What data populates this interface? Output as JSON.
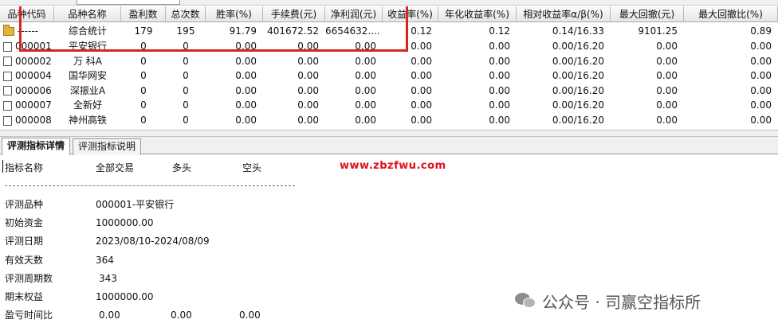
{
  "grid": {
    "columns": [
      "品种代码",
      "品种名称",
      "盈利数",
      "总次数",
      "胜率(%)",
      "手续费(元)",
      "净利润(元)",
      "收益率(%)",
      "年化收益率(%)",
      "相对收益率α/β(%)",
      "最大回撤(元)",
      "最大回撤比(%)"
    ],
    "summary_row": {
      "code": "------",
      "name": "综合统计",
      "win": "179",
      "total": "195",
      "winrate": "91.79",
      "fee": "401672.52",
      "profit": "6654632....",
      "ret": "0.12",
      "annual": "0.12",
      "alpha": "0.14/16.33",
      "maxdd": "9101.25",
      "maxddpct": "0.89"
    },
    "rows": [
      {
        "code": "000001",
        "name": "平安银行",
        "win": "0",
        "total": "0",
        "winrate": "0.00",
        "fee": "0.00",
        "profit": "0.00",
        "ret": "0.00",
        "annual": "0.00",
        "alpha": "0.00/16.20",
        "maxdd": "0.00",
        "maxddpct": "0.00"
      },
      {
        "code": "000002",
        "name": "万 科A",
        "win": "0",
        "total": "0",
        "winrate": "0.00",
        "fee": "0.00",
        "profit": "0.00",
        "ret": "0.00",
        "annual": "0.00",
        "alpha": "0.00/16.20",
        "maxdd": "0.00",
        "maxddpct": "0.00"
      },
      {
        "code": "000004",
        "name": "国华网安",
        "win": "0",
        "total": "0",
        "winrate": "0.00",
        "fee": "0.00",
        "profit": "0.00",
        "ret": "0.00",
        "annual": "0.00",
        "alpha": "0.00/16.20",
        "maxdd": "0.00",
        "maxddpct": "0.00"
      },
      {
        "code": "000006",
        "name": "深振业A",
        "win": "0",
        "total": "0",
        "winrate": "0.00",
        "fee": "0.00",
        "profit": "0.00",
        "ret": "0.00",
        "annual": "0.00",
        "alpha": "0.00/16.20",
        "maxdd": "0.00",
        "maxddpct": "0.00"
      },
      {
        "code": "000007",
        "name": "全新好",
        "win": "0",
        "total": "0",
        "winrate": "0.00",
        "fee": "0.00",
        "profit": "0.00",
        "ret": "0.00",
        "annual": "0.00",
        "alpha": "0.00/16.20",
        "maxdd": "0.00",
        "maxddpct": "0.00"
      },
      {
        "code": "000008",
        "name": "神州高铁",
        "win": "0",
        "total": "0",
        "winrate": "0.00",
        "fee": "0.00",
        "profit": "0.00",
        "ret": "0.00",
        "annual": "0.00",
        "alpha": "0.00/16.20",
        "maxdd": "0.00",
        "maxddpct": "0.00"
      }
    ]
  },
  "tabs": [
    "评测指标详情",
    "评测指标说明"
  ],
  "detail": {
    "header": {
      "label": "指标名称",
      "all": "全部交易",
      "long": "多头",
      "short": "空头"
    },
    "items": [
      {
        "label": "评测品种",
        "value": "000001-平安银行"
      },
      {
        "label": "初始资金",
        "value": "1000000.00"
      },
      {
        "label": "评测日期",
        "value": "2023/08/10-2024/08/09"
      },
      {
        "label": "有效天数",
        "value": "364"
      },
      {
        "label": "评测周期数",
        "value": "343"
      },
      {
        "label": "期末权益",
        "value": "1000000.00"
      }
    ],
    "ratio_row": {
      "label": "盈亏时间比",
      "all": "0.00",
      "long": "0.00",
      "short": "0.00"
    }
  },
  "watermark": "www.zbzfwu.com",
  "brand": "公众号 · 司赢空指标所",
  "colors": {
    "highlight_box": "#d9251d",
    "watermark": "#e0101a",
    "folder": "#e2b33c"
  },
  "icons": [
    "folder-icon",
    "checkbox-icon",
    "wechat-icon"
  ]
}
